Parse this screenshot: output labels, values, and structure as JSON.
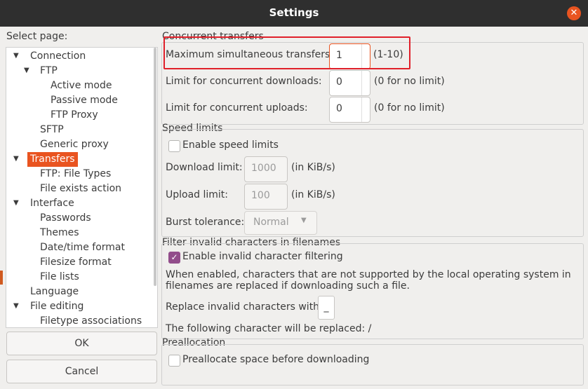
{
  "window": {
    "title": "Settings"
  },
  "left": {
    "select_page_label": "Select page:",
    "tree": [
      {
        "label": "Connection",
        "indent": 0,
        "arrow": "▼"
      },
      {
        "label": "FTP",
        "indent": 1,
        "arrow": "▼"
      },
      {
        "label": "Active mode",
        "indent": 2,
        "arrow": ""
      },
      {
        "label": "Passive mode",
        "indent": 2,
        "arrow": ""
      },
      {
        "label": "FTP Proxy",
        "indent": 2,
        "arrow": ""
      },
      {
        "label": "SFTP",
        "indent": 1,
        "arrow": ""
      },
      {
        "label": "Generic proxy",
        "indent": 1,
        "arrow": ""
      },
      {
        "label": "Transfers",
        "indent": 0,
        "arrow": "▼",
        "selected": true
      },
      {
        "label": "FTP: File Types",
        "indent": 1,
        "arrow": ""
      },
      {
        "label": "File exists action",
        "indent": 1,
        "arrow": ""
      },
      {
        "label": "Interface",
        "indent": 0,
        "arrow": "▼"
      },
      {
        "label": "Passwords",
        "indent": 1,
        "arrow": ""
      },
      {
        "label": "Themes",
        "indent": 1,
        "arrow": ""
      },
      {
        "label": "Date/time format",
        "indent": 1,
        "arrow": ""
      },
      {
        "label": "Filesize format",
        "indent": 1,
        "arrow": ""
      },
      {
        "label": "File lists",
        "indent": 1,
        "arrow": ""
      },
      {
        "label": "Language",
        "indent": 0,
        "arrow": ""
      },
      {
        "label": "File editing",
        "indent": 0,
        "arrow": "▼"
      },
      {
        "label": "Filetype associations",
        "indent": 1,
        "arrow": ""
      }
    ],
    "ok_button": "OK",
    "cancel_button": "Cancel"
  },
  "concurrent": {
    "title": "Concurrent transfers",
    "max_label": "Maximum simultaneous transfers:",
    "max_value": "1",
    "max_hint": "(1-10)",
    "downloads_label": "Limit for concurrent downloads:",
    "downloads_value": "0",
    "downloads_hint": "(0 for no limit)",
    "uploads_label": "Limit for concurrent uploads:",
    "uploads_value": "0",
    "uploads_hint": "(0 for no limit)"
  },
  "speed": {
    "title": "Speed limits",
    "enable_label": "Enable speed limits",
    "download_label": "Download limit:",
    "download_value": "1000",
    "download_unit": "(in KiB/s)",
    "upload_label": "Upload limit:",
    "upload_value": "100",
    "upload_unit": "(in KiB/s)",
    "burst_label": "Burst tolerance:",
    "burst_value": "Normal"
  },
  "filter": {
    "title": "Filter invalid characters in filenames",
    "enable_label": "Enable invalid character filtering",
    "description_line1": "When enabled, characters that are not supported by the local operating system in",
    "description_line2": "filenames are replaced if downloading such a file.",
    "replace_label": "Replace invalid characters with:",
    "replace_value": "_",
    "following_label": "The following character will be replaced: /"
  },
  "prealloc": {
    "title": "Preallocation",
    "checkbox_label": "Preallocate space before downloading"
  },
  "colors": {
    "accent": "#e95420",
    "checkbox": "#924d8b",
    "highlight": "#e0202a"
  }
}
